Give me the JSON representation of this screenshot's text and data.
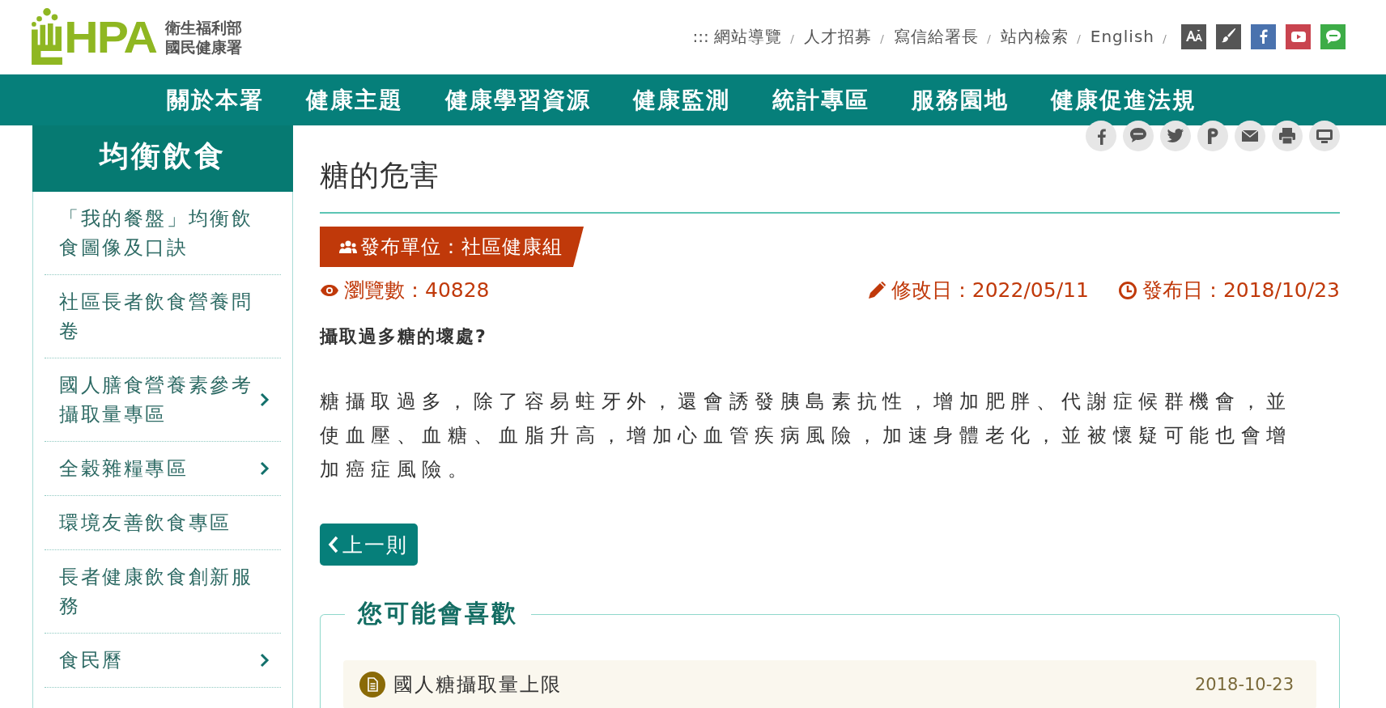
{
  "header": {
    "logo": {
      "mark": "HPA",
      "org_lines": [
        "衛生福利部",
        "國民健康署"
      ]
    },
    "accesskey": ":::",
    "top_links": [
      "網站導覽",
      "人才招募",
      "寫信給署長",
      "站內檢索",
      "English"
    ],
    "tool_icons": [
      {
        "kind": "font-size"
      },
      {
        "kind": "theme"
      },
      {
        "kind": "facebook"
      },
      {
        "kind": "youtube"
      },
      {
        "kind": "line"
      }
    ]
  },
  "nav": {
    "items": [
      "關於本署",
      "健康主題",
      "健康學習資源",
      "健康監測",
      "統計專區",
      "服務園地",
      "健康促進法規"
    ]
  },
  "sidebar": {
    "title": "均衡飲食",
    "items": [
      {
        "label": "「我的餐盤」均衡飲食圖像及口訣",
        "kind": "link"
      },
      {
        "label": "社區長者飲食營養問卷",
        "kind": "link"
      },
      {
        "label": "國人膳食營養素參考攝取量專區",
        "kind": "submenu"
      },
      {
        "label": "全穀雜糧專區",
        "kind": "submenu"
      },
      {
        "label": "環境友善飲食專區",
        "kind": "link"
      },
      {
        "label": "長者健康飲食創新服務",
        "kind": "link"
      },
      {
        "label": "食民曆",
        "kind": "submenu"
      }
    ]
  },
  "article": {
    "share_icons": [
      {
        "kind": "facebook"
      },
      {
        "kind": "line"
      },
      {
        "kind": "twitter"
      },
      {
        "kind": "plurk"
      },
      {
        "kind": "email"
      },
      {
        "kind": "print"
      },
      {
        "kind": "share"
      }
    ],
    "title": "糖的危害",
    "publisher": "發布單位：社區健康組",
    "views": "瀏覽數：40828",
    "modified": "修改日：2022/05/11",
    "published": "發布日：2018/10/23",
    "question": "攝取過多糖的壞處?",
    "body": "糖攝取過多，除了容易蛀牙外，還會誘發胰島素抗性，增加肥胖、代謝症候群機會，並使血壓、血糖、血脂升高，增加心血管疾病風險，加速身體老化，並被懷疑可能也會增加癌症風險。",
    "prev_button": "上一則"
  },
  "related": {
    "title": "您可能會喜歡",
    "items": [
      {
        "title": "國人糖攝取量上限",
        "date": "2018-10-23"
      }
    ]
  }
}
